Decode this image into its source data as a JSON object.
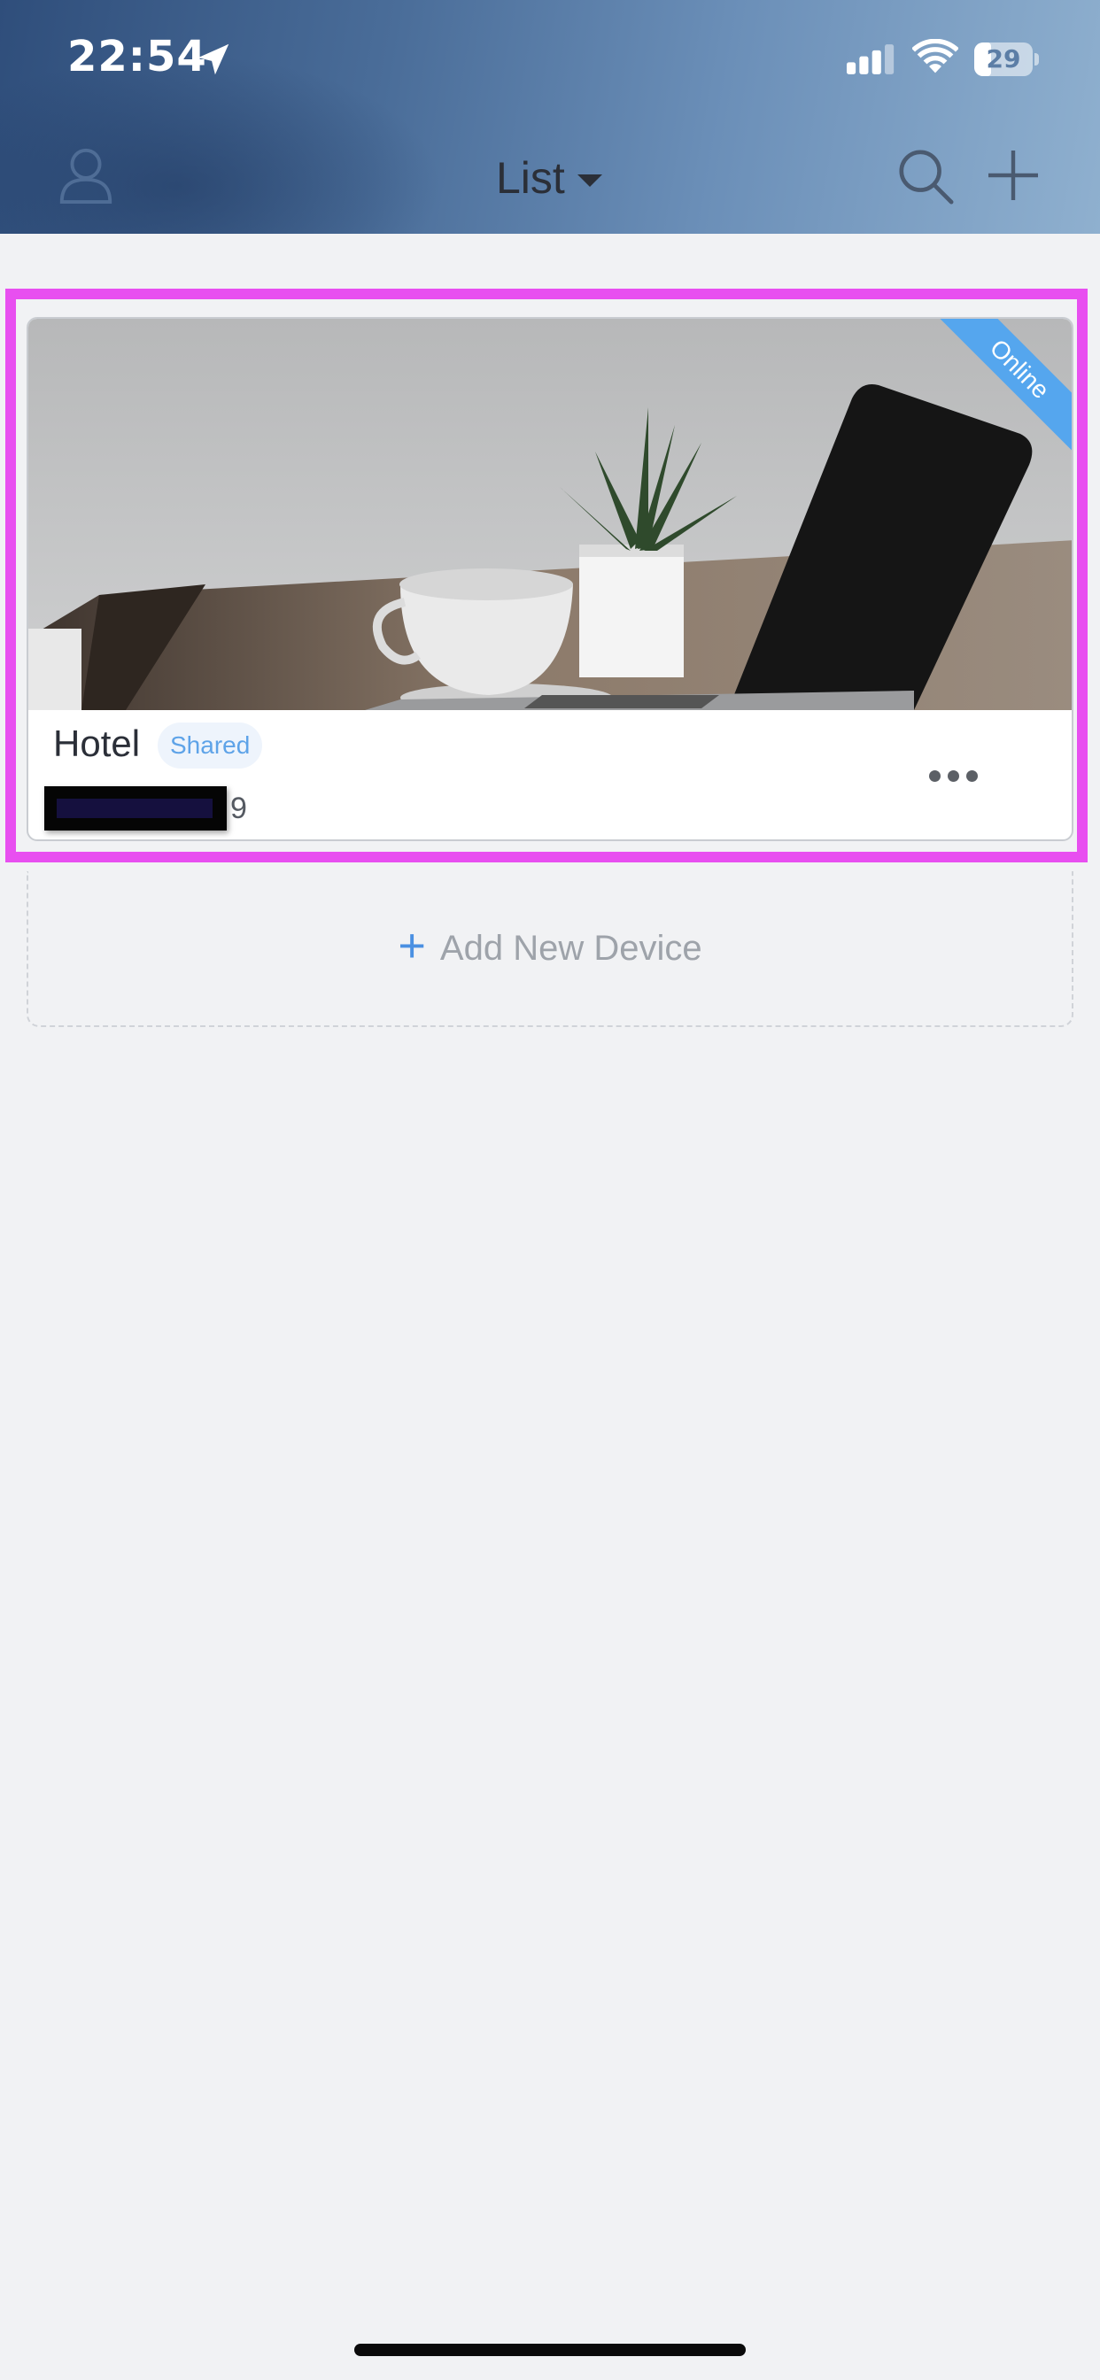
{
  "status_bar": {
    "time": "22:54",
    "battery": "29",
    "battery_level": 0.29,
    "icons": [
      "location-arrow-icon",
      "cellular-signal-icon",
      "wifi-icon",
      "battery-icon"
    ]
  },
  "header": {
    "title": "List",
    "icons": [
      "user-icon",
      "caret-down-icon",
      "search-icon",
      "plus-icon"
    ],
    "colors": {
      "gradient_start": "#2f4e7b",
      "gradient_end": "#8fb0cf"
    }
  },
  "device_card": {
    "status": "Online",
    "name": "Hotel",
    "badge": "Shared",
    "id_suffix": "9",
    "more_icon": "more-icon",
    "colors": {
      "status": "#55a6ee",
      "badge_text": "#5ea3e8",
      "highlight": "#e84ff0"
    }
  },
  "add_device": {
    "label": "Add New Device",
    "icon": "plus-icon",
    "colors": {
      "accent": "#4a90e2"
    }
  }
}
